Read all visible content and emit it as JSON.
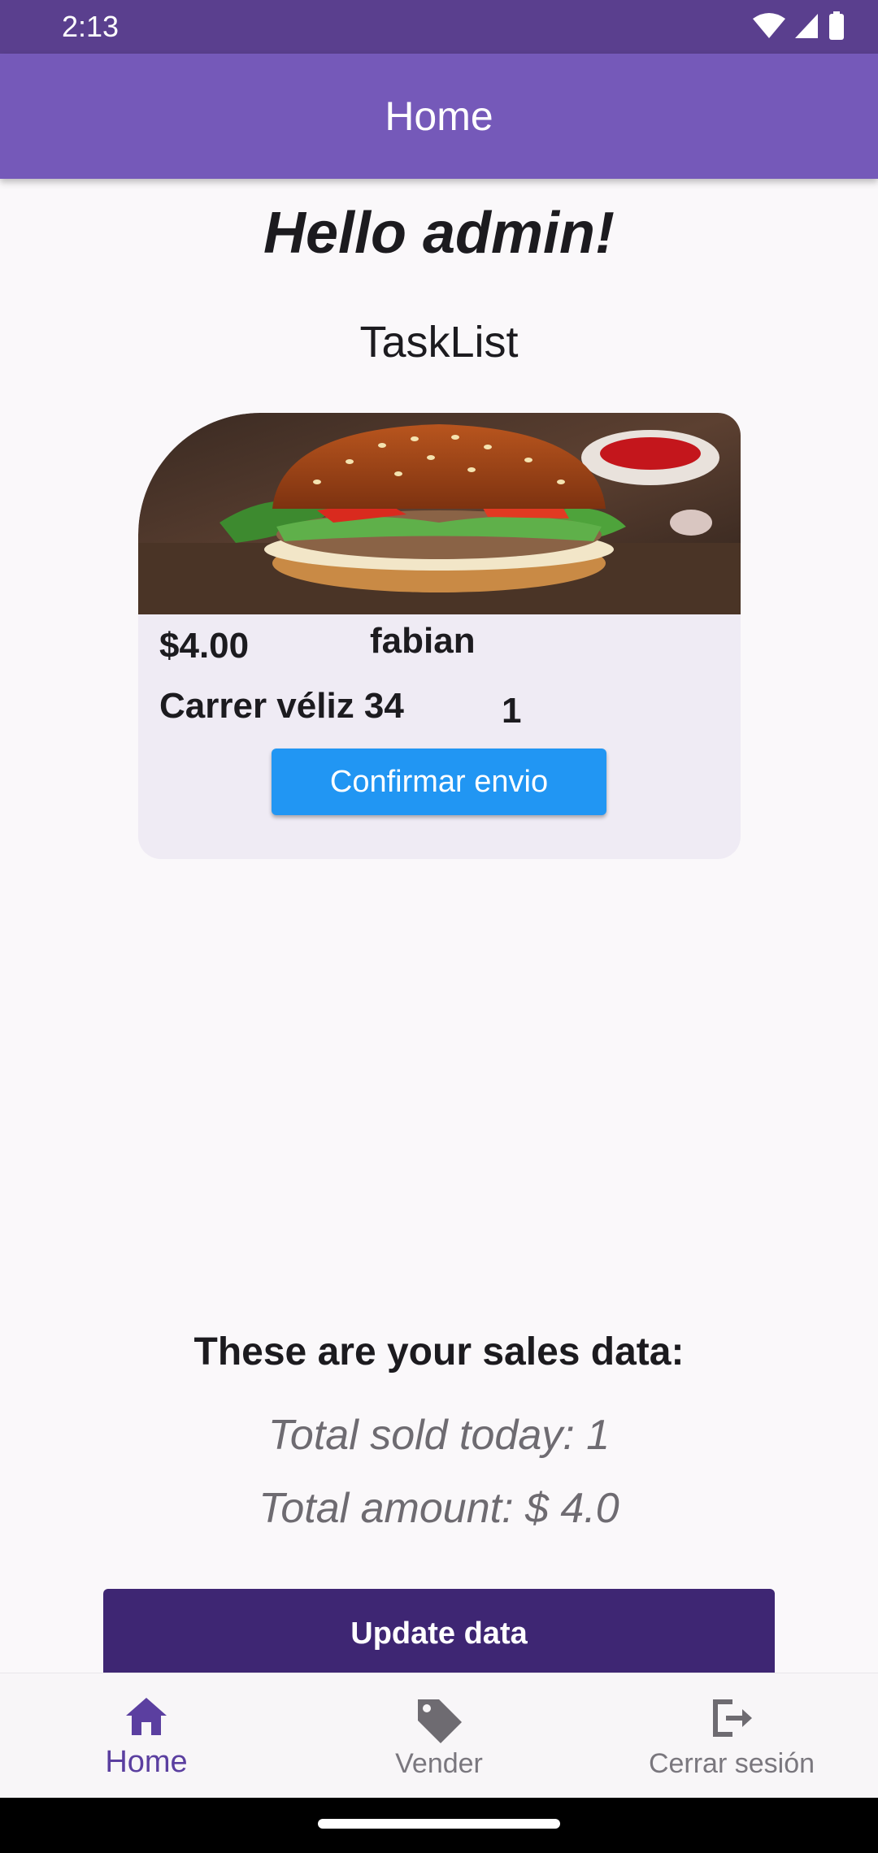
{
  "status_bar": {
    "time": "2:13"
  },
  "app_bar": {
    "title": "Home"
  },
  "greeting": "Hello admin!",
  "section_title": "TaskList",
  "card": {
    "price": "$4.00",
    "customer": "fabian",
    "address": "Carrer véliz 34",
    "quantity": "1",
    "button_label": "Confirmar envio",
    "image_icon": "burger-photo"
  },
  "sales": {
    "heading": "These are your sales data:",
    "sold_today": "Total sold today: 1",
    "total_amount": "Total amount: $ 4.0",
    "update_label": "Update data"
  },
  "bottom_nav": {
    "items": [
      {
        "label": "Home",
        "icon": "home-icon",
        "active": true
      },
      {
        "label": "Vender",
        "icon": "tag-icon",
        "active": false
      },
      {
        "label": "Cerrar sesión",
        "icon": "logout-icon",
        "active": false
      }
    ]
  },
  "colors": {
    "status_bar": "#5a3f8e",
    "app_bar": "#7559b9",
    "card_bg": "#efebf4",
    "confirm_button": "#2196f3",
    "update_button": "#3e2673",
    "nav_active": "#5b3fa0"
  }
}
